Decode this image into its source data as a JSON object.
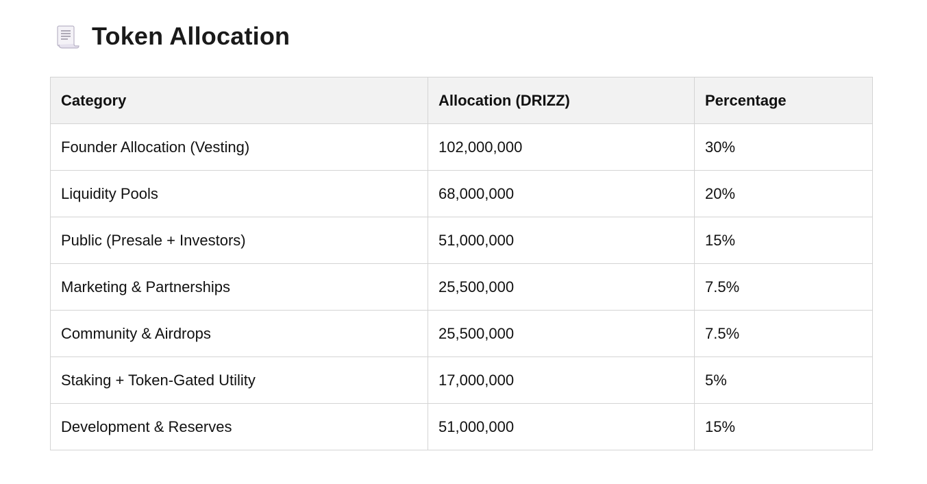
{
  "header": {
    "icon": "scroll-document-icon",
    "title": "Token Allocation"
  },
  "table": {
    "columns": [
      "Category",
      "Allocation (DRIZZ)",
      "Percentage"
    ],
    "rows": [
      [
        "Founder Allocation (Vesting)",
        "102,000,000",
        "30%"
      ],
      [
        "Liquidity Pools",
        "68,000,000",
        "20%"
      ],
      [
        "Public (Presale + Investors)",
        "51,000,000",
        "15%"
      ],
      [
        "Marketing & Partnerships",
        "25,500,000",
        "7.5%"
      ],
      [
        "Community & Airdrops",
        "25,500,000",
        "7.5%"
      ],
      [
        "Staking + Token-Gated Utility",
        "17,000,000",
        "5%"
      ],
      [
        "Development & Reserves",
        "51,000,000",
        "15%"
      ]
    ]
  }
}
